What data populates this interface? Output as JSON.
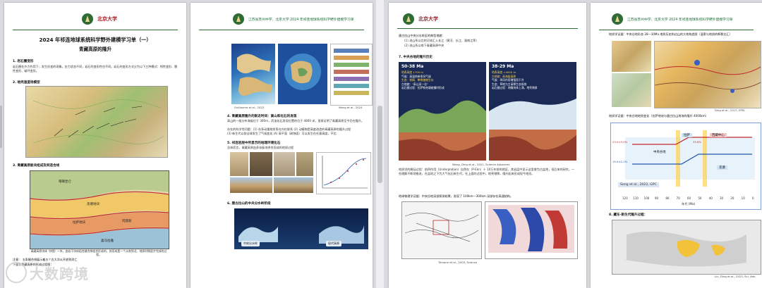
{
  "header": {
    "logo_text": "北京大学",
    "course_line": "江苏省苏州中学、北京大学 2024 年祁连地球系统科学野外建模学习单"
  },
  "page1": {
    "title": "2024 年祁连地球系统科学野外建模学习单（一）",
    "subtitle": "青藏高原的隆升",
    "s1": "1.    岩石圈变形",
    "s1_text": "岩石圈在外力作用下，发生形变的现象。应力状态不同，岩石的变形性也不同。岩石的变形方式分为以下三种模式：韧性变形、脆性变形、破坏变形。",
    "s2": "2.    地壳速度场模型",
    "s3": "3.    青藏高原板块组成及同造合线",
    "map_caption": "青藏高原块体 \"拼图\" 一块，由若干块体组合缝合带组合形成的，其形成是一个从南到北、地质时期逐步完成的过程。",
    "note": "注意：    五条缝合线展示着五个古大洋从开放到消亡",
    "note2": "下面为青藏高原的形成过程图：",
    "map_labels": [
      "喀喇昆仑",
      "羌塘地块",
      "拉萨地块",
      "冈底斯",
      "喜马拉雅"
    ]
  },
  "page2": {
    "s4": "4.    青藏高原隆升的新近时间：高山和化石的发现",
    "s4_text": "高山的一般分布海拔位于 300m，而该化石发现位置的位于 4800 米，直接证明了青藏高原至今仍在隆升。",
    "s4_text2": "存在的科学性问题：(1) 存多动植物关系在内在联系    (2) 动植物是高度改造的青藏高原的隆升过程",
    "s4_text3": "(3) 新生代以前全球发生了气候变化    (4) 高平面（剥蚀面）可以发生在任意高度，不比",
    "s5": "5.    祁连岩层中所显示的地理环境化石",
    "s5_text": "总体而言，青藏高原由多块板块拼合而成的地质过程",
    "s6": "6.    唐古拉山的中央分水岭阶段",
    "cap_left": "Guillaume et al., 2022",
    "cap_right": "Wang et al., 2024",
    "pill_left": "中央分水岭",
    "pill_right": "现代高原"
  },
  "page3": {
    "intro": "唐古拉山中央分水岭区的典型地貌：",
    "item1": "(1)    流山系以北的河流汇入长江（黄河、长江、湄南江等）",
    "item2": "(2)    流山系以南下青藏高原中央",
    "s7": "7.    中央谷地的隆升历史",
    "panel_a_title": "50-38 Ma",
    "panel_a_lines": [
      "地表高度 1700 m",
      "气候：高湿热带季风气候",
      "生态：棕榈、攀缘植物生存",
      "古地貌：\"高山深一谷\"",
      "岩石圈过程：拉萨和羌塘碰撞时形成"
    ],
    "panel_b_title": "38-29 Ma",
    "panel_b_lines": [
      "地表高度 >4000 m",
      "古地貌：高海拔高原",
      "气候：季风作用增强而干冷",
      "生态：草地为主高寒生态系统",
      "岩石圈过程：地幔块体上涌，地壳增厚"
    ],
    "fig_caption": "Wang, Ding et al., 2021, Science Advances",
    "body_text": "地质学的概括过程：前四作用（Underplation）自然在（P-Ekn）十 10万年前的地区，其岩层中显示这里曾为古盆地，但后来的研究，一些理解不断地推进，在盆地之下为大气化石新生代，在上面的过程中，地壳增厚，隆升起来形成现今地形。",
    "s_seis": "地球物理学证据：中央谷地深部探测结果，发现了 100km—300km 深部存在高速结构。",
    "seis_caption": "Tilmann et al., 2003, Science"
  },
  "page4": {
    "s_hist": "地质学证据：中央谷地形态 28—30Ma 地质历史和边山的大地构造图（温莱与地质的断裂交汇）",
    "map_caption": "Ding et al., 2017, EPSL",
    "s_time": "地质学证据：中央谷地地势变化（拉萨地块与唐古拉山地块的隆升 4000km）",
    "chart_labels": [
      "拉萨",
      "羌塘",
      "西藏中心",
      "中央谷地"
    ],
    "ages": [
      "23.0±3.0%",
      "35.8%",
      "15.0±2.1%"
    ],
    "ref": "Song et al., 2022, GPC",
    "s8": "8.    藏东·新生代隆升过程：",
    "map2_caption": "Liu, Ding et al., 2023, Sci. Adv."
  },
  "chart_data": {
    "type": "line",
    "title": "",
    "xlabel": "年代 (Ma)",
    "ylabel": "",
    "x_ticks": [
      120,
      110,
      100,
      90,
      80,
      70,
      60,
      50,
      40,
      30,
      20,
      10,
      0
    ],
    "series": [
      {
        "name": "拉萨",
        "x": [
          120,
          90,
          60,
          40,
          30,
          20,
          0
        ],
        "values": [
          1,
          1,
          2,
          3,
          4,
          4,
          4
        ]
      },
      {
        "name": "羌塘",
        "x": [
          120,
          90,
          60,
          40,
          30,
          20,
          0
        ],
        "values": [
          1,
          2,
          3,
          4,
          4,
          4,
          4
        ]
      }
    ]
  },
  "watermark": "大数跨境",
  "colors": {
    "green": "#2e6b35",
    "red": "#a3222a",
    "blue": "#0047b3"
  }
}
